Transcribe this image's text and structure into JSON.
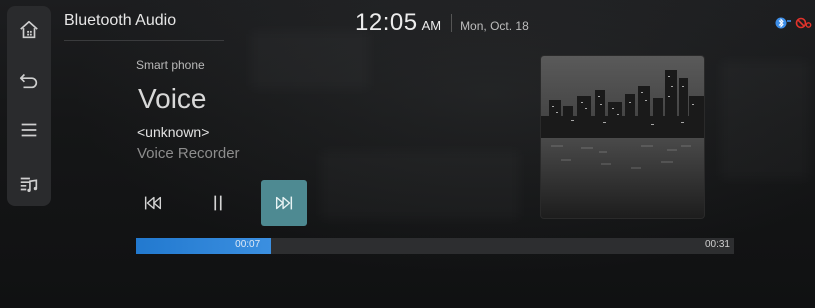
{
  "header": {
    "title": "Bluetooth Audio",
    "time": "12:05",
    "ampm": "AM",
    "date": "Mon, Oct. 18"
  },
  "rail": {
    "items": [
      {
        "icon": "home-icon"
      },
      {
        "icon": "back-icon"
      },
      {
        "icon": "menu-icon"
      },
      {
        "icon": "playlist-icon"
      }
    ]
  },
  "status": {
    "icons": [
      "bluetooth-icon",
      "no-signal-icon"
    ],
    "bluetooth_color": "#3d8ee8",
    "alert_color": "#e0332b"
  },
  "track": {
    "source": "Smart phone",
    "title": "Voice",
    "artist": "<unknown>",
    "album": "Voice Recorder"
  },
  "controls": {
    "prev": "previous-track-icon",
    "pause": "pause-icon",
    "next": "next-track-icon",
    "active": "next"
  },
  "progress": {
    "elapsed": "00:07",
    "duration": "00:31",
    "fraction": 0.226,
    "fill_color": "#2a7fd6"
  },
  "colors": {
    "accent": "#4e8a92"
  }
}
